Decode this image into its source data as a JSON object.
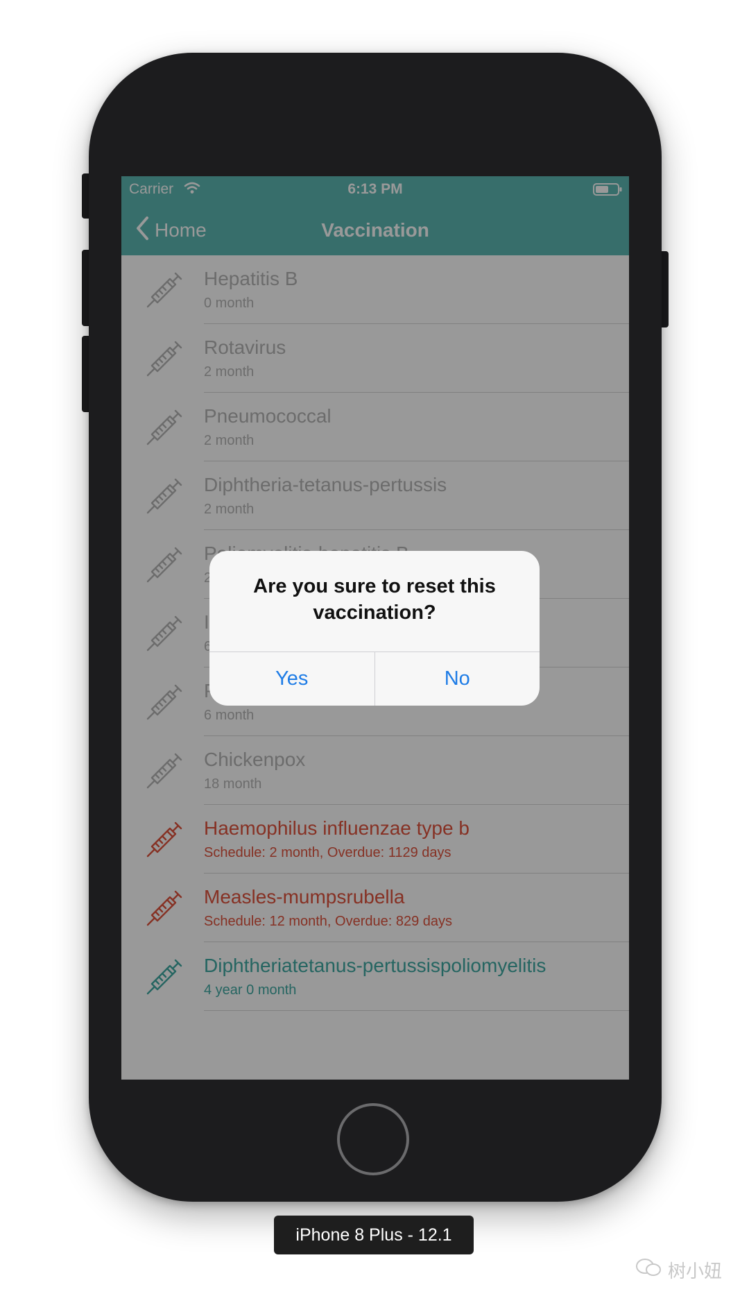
{
  "status_bar": {
    "carrier": "Carrier",
    "time": "6:13 PM"
  },
  "navbar": {
    "back_label": "Home",
    "title": "Vaccination"
  },
  "vaccines": [
    {
      "name": "Hepatitis B",
      "detail": "0 month",
      "status": "normal"
    },
    {
      "name": "Rotavirus",
      "detail": "2 month",
      "status": "normal"
    },
    {
      "name": "Pneumococcal",
      "detail": "2 month",
      "status": "normal"
    },
    {
      "name": "Diphtheria-tetanus-pertussis",
      "detail": "2 month",
      "status": "normal"
    },
    {
      "name": "Poliomyelitis-hepatitis B",
      "detail": "2 month",
      "status": "normal"
    },
    {
      "name": "I",
      "detail": "6",
      "status": "normal"
    },
    {
      "name": "P",
      "detail": "6 month",
      "status": "normal"
    },
    {
      "name": "Chickenpox",
      "detail": "18 month",
      "status": "normal"
    },
    {
      "name": "Haemophilus influenzae type b",
      "detail": "Schedule: 2 month, Overdue: 1129 days",
      "status": "overdue"
    },
    {
      "name": "Measles-mumpsrubella",
      "detail": "Schedule: 12 month, Overdue: 829 days",
      "status": "overdue"
    },
    {
      "name": "Diphtheriatetanus-pertussispoliomyelitis",
      "detail": "4 year 0 month",
      "status": "upcoming"
    }
  ],
  "alert": {
    "message": "Are you sure to reset this vaccination?",
    "confirm_label": "Yes",
    "cancel_label": "No"
  },
  "device_label": "iPhone 8 Plus - 12.1",
  "watermark": "树小妞",
  "colors": {
    "navbar": "#5cb8b2",
    "overdue": "#e0533d",
    "upcoming": "#3fa9a2",
    "normal": "#b5b5b5",
    "alert_button": "#1e7ce6"
  }
}
